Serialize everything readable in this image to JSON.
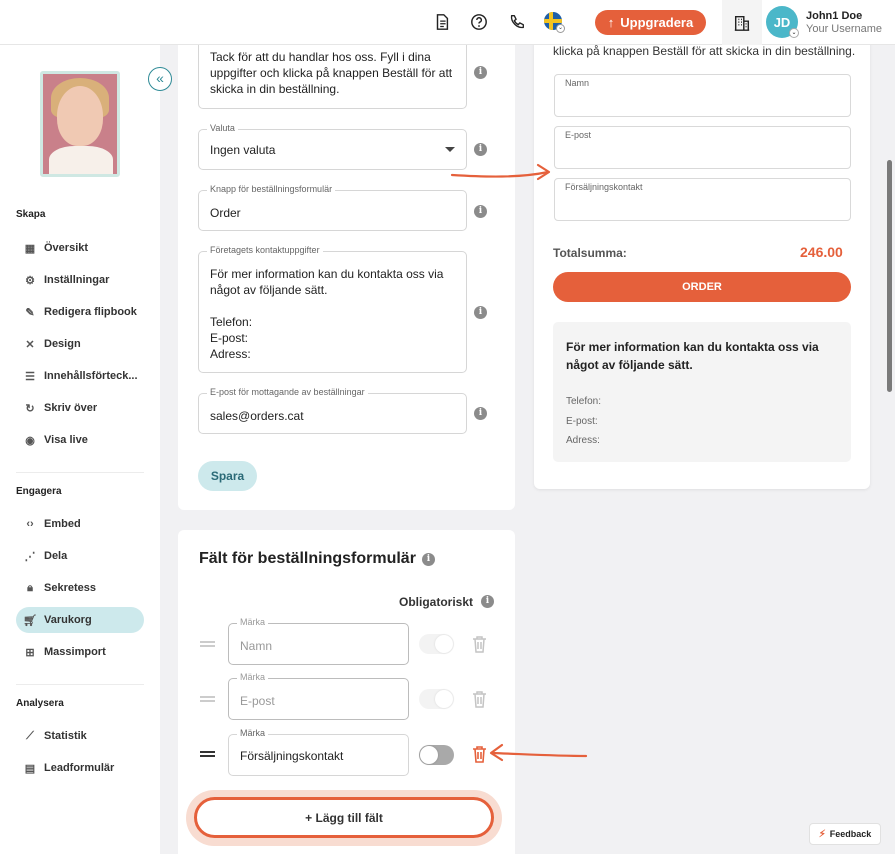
{
  "header": {
    "upgrade_label": "Uppgradera",
    "avatar_initials": "JD",
    "user_name": "John1 Doe",
    "user_sub": "Your Username"
  },
  "sidebar": {
    "skapa_title": "Skapa",
    "skapa_items": [
      {
        "label": "Översikt",
        "icon": "layout-icon"
      },
      {
        "label": "Inställningar",
        "icon": "gear-icon"
      },
      {
        "label": "Redigera flipbook",
        "icon": "pencil-icon"
      },
      {
        "label": "Design",
        "icon": "design-tools-icon"
      },
      {
        "label": "Innehållsförteck...",
        "icon": "list-icon"
      },
      {
        "label": "Skriv över",
        "icon": "refresh-icon"
      },
      {
        "label": "Visa live",
        "icon": "eye-icon"
      }
    ],
    "engagera_title": "Engagera",
    "engagera_items": [
      {
        "label": "Embed",
        "icon": "code-icon"
      },
      {
        "label": "Dela",
        "icon": "share-icon"
      },
      {
        "label": "Sekretess",
        "icon": "lock-icon"
      },
      {
        "label": "Varukorg",
        "icon": "cart-icon"
      },
      {
        "label": "Massimport",
        "icon": "import-icon"
      }
    ],
    "analysera_title": "Analysera",
    "analysera_items": [
      {
        "label": "Statistik",
        "icon": "chart-icon"
      },
      {
        "label": "Leadformulär",
        "icon": "form-icon"
      }
    ]
  },
  "settings": {
    "intro_text_lines": [
      "Tack för att du handlar hos oss. Fyll i dina",
      "uppgifter och klicka på knappen Beställ för att",
      "skicka in din beställning."
    ],
    "currency_label": "Valuta",
    "currency_value": "Ingen valuta",
    "button_label": "Knapp för beställningsformulär",
    "button_value": "Order",
    "contact_label": "Företagets kontaktuppgifter",
    "contact_lines": [
      "För mer information kan du kontakta oss via",
      "något av följande sätt.",
      "",
      "Telefon:",
      "E-post:",
      "Adress:"
    ],
    "email_label": "E-post för mottagande av beställningar",
    "email_value": "sales@orders.cat",
    "save_label": "Spara"
  },
  "fields_card": {
    "title": "Fält för beställningsformulär",
    "required_label": "Obligatoriskt",
    "rows": [
      {
        "label": "Märka",
        "value": "Namn",
        "placeholder": true
      },
      {
        "label": "Märka",
        "value": "E-post",
        "placeholder": true
      },
      {
        "label": "Märka",
        "value": "Försäljningskontakt",
        "placeholder": false
      }
    ],
    "add_label": "+ Lägg till fält"
  },
  "preview": {
    "intro_tail": "klicka på knappen Beställ för att skicka in din beställning.",
    "fields": [
      "Namn",
      "E-post",
      "Försäljningskontakt"
    ],
    "total_label": "Totalsumma:",
    "total_value": "246.00",
    "order_label": "ORDER",
    "contact_title": "För mer information kan du kontakta oss via något av följande sätt.",
    "contact_lines": [
      "Telefon:",
      "E-post:",
      "Adress:"
    ]
  },
  "feedback_label": "Feedback",
  "colors": {
    "accent": "#e5603b",
    "teal": "#2e8a96",
    "active_bg": "#cde9ec"
  }
}
